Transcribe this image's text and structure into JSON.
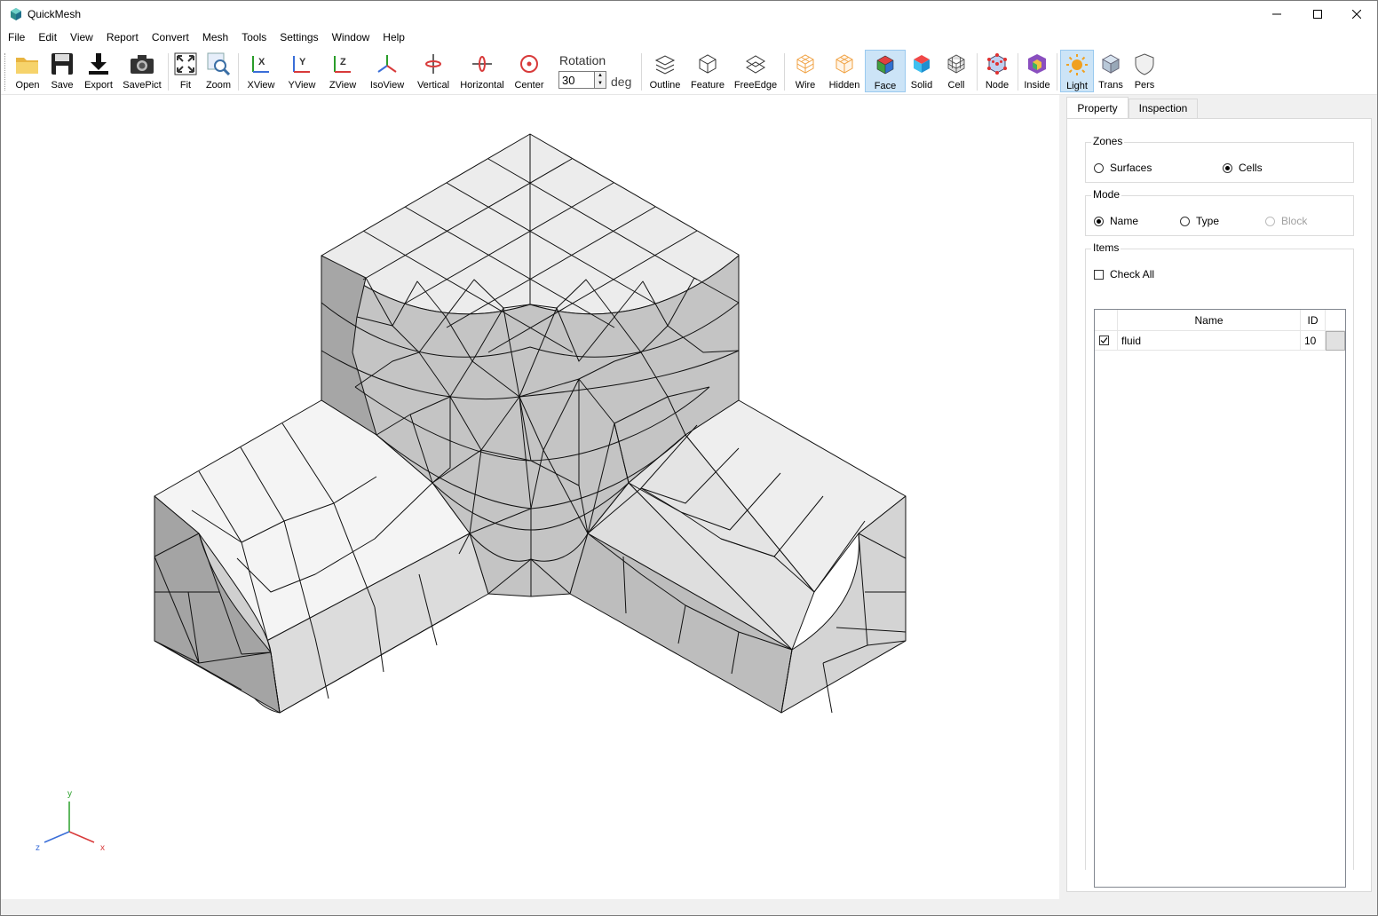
{
  "window": {
    "title": "QuickMesh",
    "controls": {
      "minimize": "—",
      "maximize": "☐",
      "close": "✕"
    }
  },
  "menu": [
    "File",
    "Edit",
    "View",
    "Report",
    "Convert",
    "Mesh",
    "Tools",
    "Settings",
    "Window",
    "Help"
  ],
  "toolbar": {
    "open": "Open",
    "save": "Save",
    "export": "Export",
    "savepict": "SavePict",
    "fit": "Fit",
    "zoom": "Zoom",
    "xview": "XView",
    "yview": "YView",
    "zview": "ZView",
    "isoview": "IsoView",
    "vertical": "Vertical",
    "horizontal": "Horizontal",
    "center": "Center",
    "rotation_label": "Rotation",
    "rotation_value": "30",
    "rotation_unit": "deg",
    "outline": "Outline",
    "feature": "Feature",
    "freeedge": "FreeEdge",
    "wire": "Wire",
    "hidden": "Hidden",
    "face": "Face",
    "solid": "Solid",
    "cell": "Cell",
    "node": "Node",
    "inside": "Inside",
    "light": "Light",
    "trans": "Trans",
    "pers": "Pers"
  },
  "axes": {
    "x": "x",
    "y": "y",
    "z": "z"
  },
  "panel": {
    "tabs": [
      "Property",
      "Inspection"
    ],
    "zones": {
      "title": "Zones",
      "surfaces": "Surfaces",
      "cells": "Cells",
      "selected": "Cells"
    },
    "mode": {
      "title": "Mode",
      "name": "Name",
      "type": "Type",
      "block": "Block",
      "selected": "Name"
    },
    "items": {
      "title": "Items",
      "check_all": "Check All",
      "columns": {
        "name": "Name",
        "id": "ID"
      },
      "rows": [
        {
          "checked": true,
          "name": "fluid",
          "id": "10"
        }
      ]
    }
  },
  "colors": {
    "accent_selected": "#cce4f7",
    "mesh_face": "#c8c8c8",
    "mesh_top": "#ececec",
    "mesh_side_dark": "#a8a8a8"
  }
}
